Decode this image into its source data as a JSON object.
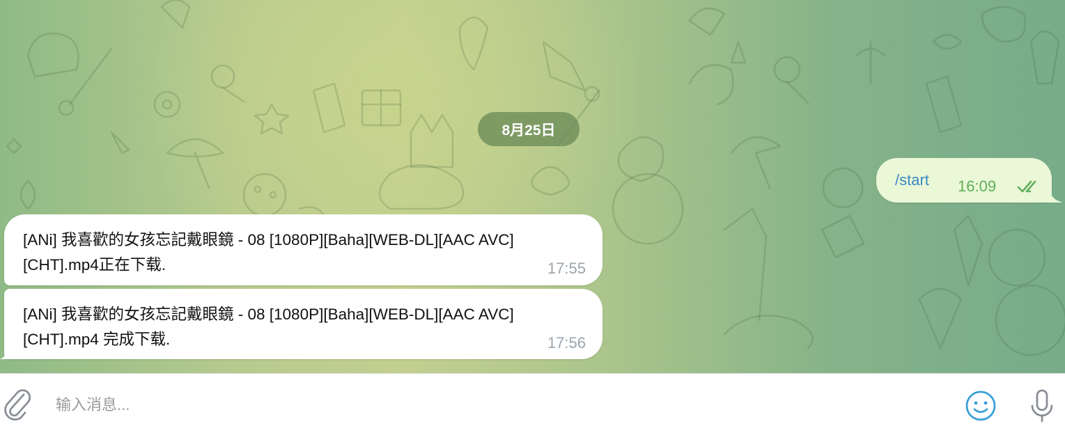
{
  "date_separator": "8月25日",
  "messages": [
    {
      "direction": "outgoing",
      "text": "/start",
      "time": "16:09",
      "status": "double-check-icon"
    },
    {
      "direction": "incoming",
      "text": "[ANi] 我喜歡的女孩忘記戴眼鏡 - 08 [1080P][Baha][WEB-DL][AAC AVC][CHT].mp4正在下载.",
      "time": "17:55"
    },
    {
      "direction": "incoming",
      "text": "[ANi] 我喜歡的女孩忘記戴眼鏡 - 08 [1080P][Baha][WEB-DL][AAC AVC][CHT].mp4 完成下载.",
      "time": "17:56"
    }
  ],
  "composer": {
    "placeholder": "输入消息...",
    "value": "",
    "icons": [
      "paperclip-icon",
      "emoji-icon",
      "microphone-icon"
    ]
  },
  "colors": {
    "outgoing_bubble": "#eaf8d7",
    "outgoing_text": "#3a88c4",
    "outgoing_time": "#5fae5a",
    "incoming_time": "#9aa5ae",
    "icon_blue": "#3aa0d8",
    "date_pill": "#6c8c58"
  }
}
